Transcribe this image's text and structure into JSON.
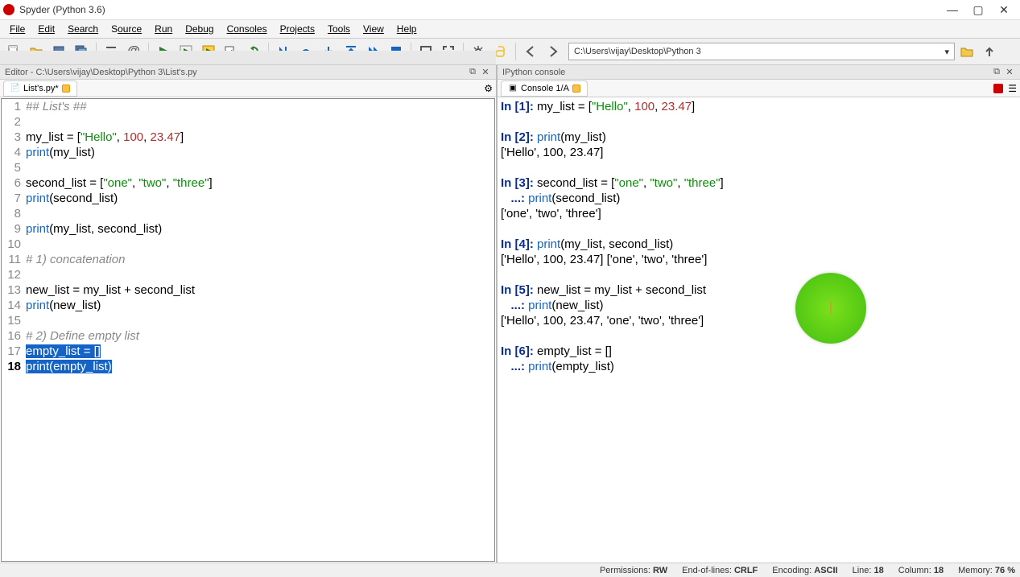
{
  "window": {
    "title": "Spyder (Python 3.6)"
  },
  "menu": {
    "file": "File",
    "edit": "Edit",
    "search": "Search",
    "source": "Source",
    "run": "Run",
    "debug": "Debug",
    "consoles": "Consoles",
    "projects": "Projects",
    "tools": "Tools",
    "view": "View",
    "help": "Help"
  },
  "toolbar": {
    "path": "C:\\Users\\vijay\\Desktop\\Python 3"
  },
  "editor_header": {
    "title": "Editor - C:\\Users\\vijay\\Desktop\\Python 3\\List's.py"
  },
  "editor_tab": {
    "label": "List's.py*"
  },
  "console_header": {
    "title": "IPython console"
  },
  "console_tab": {
    "label": "Console 1/A"
  },
  "editor_lines": [
    {
      "n": 1,
      "tokens": [
        {
          "t": "## List's ##",
          "c": "comment"
        }
      ]
    },
    {
      "n": 2,
      "tokens": []
    },
    {
      "n": 3,
      "tokens": [
        {
          "t": "my_list = ["
        },
        {
          "t": "\"Hello\"",
          "c": "str"
        },
        {
          "t": ", "
        },
        {
          "t": "100",
          "c": "num"
        },
        {
          "t": ", "
        },
        {
          "t": "23.47",
          "c": "num"
        },
        {
          "t": "]"
        }
      ]
    },
    {
      "n": 4,
      "tokens": [
        {
          "t": "print",
          "c": "kw"
        },
        {
          "t": "(my_list)"
        }
      ]
    },
    {
      "n": 5,
      "tokens": []
    },
    {
      "n": 6,
      "tokens": [
        {
          "t": "second_list = ["
        },
        {
          "t": "\"one\"",
          "c": "str"
        },
        {
          "t": ", "
        },
        {
          "t": "\"two\"",
          "c": "str"
        },
        {
          "t": ", "
        },
        {
          "t": "\"three\"",
          "c": "str"
        },
        {
          "t": "]"
        }
      ]
    },
    {
      "n": 7,
      "tokens": [
        {
          "t": "print",
          "c": "kw"
        },
        {
          "t": "(second_list)"
        }
      ]
    },
    {
      "n": 8,
      "tokens": []
    },
    {
      "n": 9,
      "tokens": [
        {
          "t": "print",
          "c": "kw"
        },
        {
          "t": "(my_list, second_list)"
        }
      ]
    },
    {
      "n": 10,
      "tokens": []
    },
    {
      "n": 11,
      "tokens": [
        {
          "t": "# 1) concatenation",
          "c": "comment"
        }
      ]
    },
    {
      "n": 12,
      "tokens": []
    },
    {
      "n": 13,
      "tokens": [
        {
          "t": "new_list = my_list + second_list"
        }
      ]
    },
    {
      "n": 14,
      "tokens": [
        {
          "t": "print",
          "c": "kw"
        },
        {
          "t": "(new_list)"
        }
      ]
    },
    {
      "n": 15,
      "tokens": []
    },
    {
      "n": 16,
      "tokens": [
        {
          "t": "# 2) Define empty list",
          "c": "comment"
        }
      ]
    },
    {
      "n": 17,
      "tokens": [
        {
          "t": "empty_list = []"
        }
      ],
      "selected": true
    },
    {
      "n": 18,
      "tokens": [
        {
          "t": "print(empty_list)"
        }
      ],
      "selected": true,
      "current": true
    }
  ],
  "console_lines": [
    {
      "type": "in",
      "n": "1",
      "tokens": [
        {
          "t": "my_list = ["
        },
        {
          "t": "\"Hello\"",
          "c": "str"
        },
        {
          "t": ", "
        },
        {
          "t": "100",
          "c": "num"
        },
        {
          "t": ", "
        },
        {
          "t": "23.47",
          "c": "num"
        },
        {
          "t": "]"
        }
      ]
    },
    {
      "type": "blank"
    },
    {
      "type": "in",
      "n": "2",
      "tokens": [
        {
          "t": "print",
          "c": "cprint"
        },
        {
          "t": "(my_list)"
        }
      ]
    },
    {
      "type": "out",
      "text": "['Hello', 100, 23.47]"
    },
    {
      "type": "blank"
    },
    {
      "type": "in",
      "n": "3",
      "tokens": [
        {
          "t": "second_list = ["
        },
        {
          "t": "\"one\"",
          "c": "str"
        },
        {
          "t": ", "
        },
        {
          "t": "\"two\"",
          "c": "str"
        },
        {
          "t": ", "
        },
        {
          "t": "\"three\"",
          "c": "str"
        },
        {
          "t": "]"
        }
      ]
    },
    {
      "type": "cont",
      "tokens": [
        {
          "t": "print",
          "c": "cprint"
        },
        {
          "t": "(second_list)"
        }
      ]
    },
    {
      "type": "out",
      "text": "['one', 'two', 'three']"
    },
    {
      "type": "blank"
    },
    {
      "type": "in",
      "n": "4",
      "tokens": [
        {
          "t": "print",
          "c": "cprint"
        },
        {
          "t": "(my_list, second_list)"
        }
      ]
    },
    {
      "type": "out",
      "text": "['Hello', 100, 23.47] ['one', 'two', 'three']"
    },
    {
      "type": "blank"
    },
    {
      "type": "in",
      "n": "5",
      "tokens": [
        {
          "t": "new_list = my_list + second_list"
        }
      ]
    },
    {
      "type": "cont",
      "tokens": [
        {
          "t": "print",
          "c": "cprint"
        },
        {
          "t": "(new_list)"
        }
      ]
    },
    {
      "type": "out",
      "text": "['Hello', 100, 23.47, 'one', 'two', 'three']"
    },
    {
      "type": "blank"
    },
    {
      "type": "in",
      "n": "6",
      "tokens": [
        {
          "t": "empty_list = []"
        }
      ]
    },
    {
      "type": "cont",
      "tokens": [
        {
          "t": "print",
          "c": "cprint"
        },
        {
          "t": "(empty_list)"
        }
      ]
    }
  ],
  "status": {
    "permissions_label": "Permissions:",
    "permissions_val": "RW",
    "eol_label": "End-of-lines:",
    "eol_val": "CRLF",
    "encoding_label": "Encoding:",
    "encoding_val": "ASCII",
    "line_label": "Line:",
    "line_val": "18",
    "col_label": "Column:",
    "col_val": "18",
    "mem_label": "Memory:",
    "mem_val": "76 %"
  },
  "cursor_glyph": "I"
}
